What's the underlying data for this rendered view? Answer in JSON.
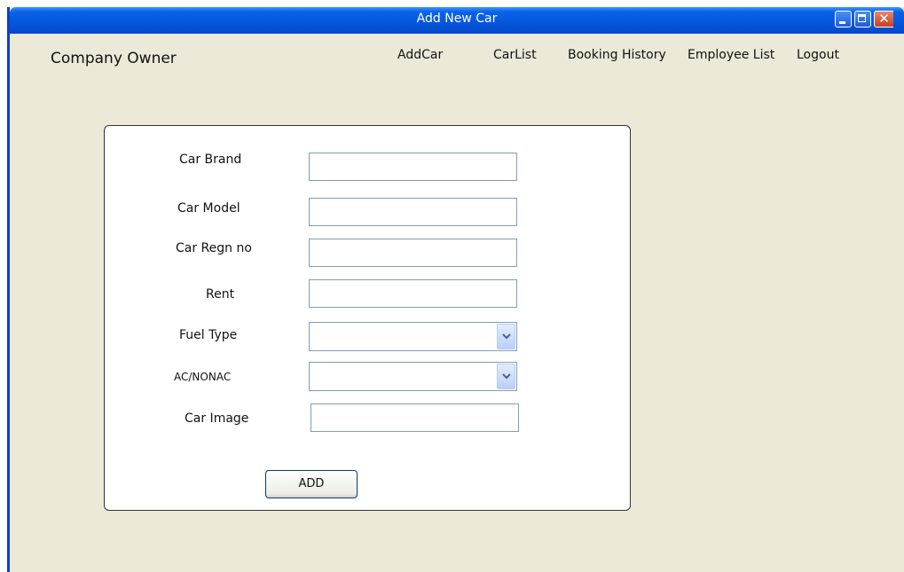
{
  "window": {
    "title": "Add New Car"
  },
  "header": {
    "brand": "Company Owner",
    "nav": [
      "AddCar",
      "CarList",
      "Booking History",
      "Employee List",
      "Logout"
    ]
  },
  "form": {
    "fields": [
      {
        "label": "Car Brand",
        "value": ""
      },
      {
        "label": "Car Model",
        "value": ""
      },
      {
        "label": "Car Regn no",
        "value": ""
      },
      {
        "label": "Rent",
        "value": ""
      },
      {
        "label": "Fuel Type",
        "selected": ""
      },
      {
        "label": "AC/NONAC",
        "selected": ""
      },
      {
        "label": "Car Image",
        "value": ""
      }
    ],
    "submit_label": "ADD"
  },
  "colors": {
    "titlebar": "#0556DC",
    "window_bg": "#ECE9D8",
    "field_border": "#7F9DB9"
  }
}
